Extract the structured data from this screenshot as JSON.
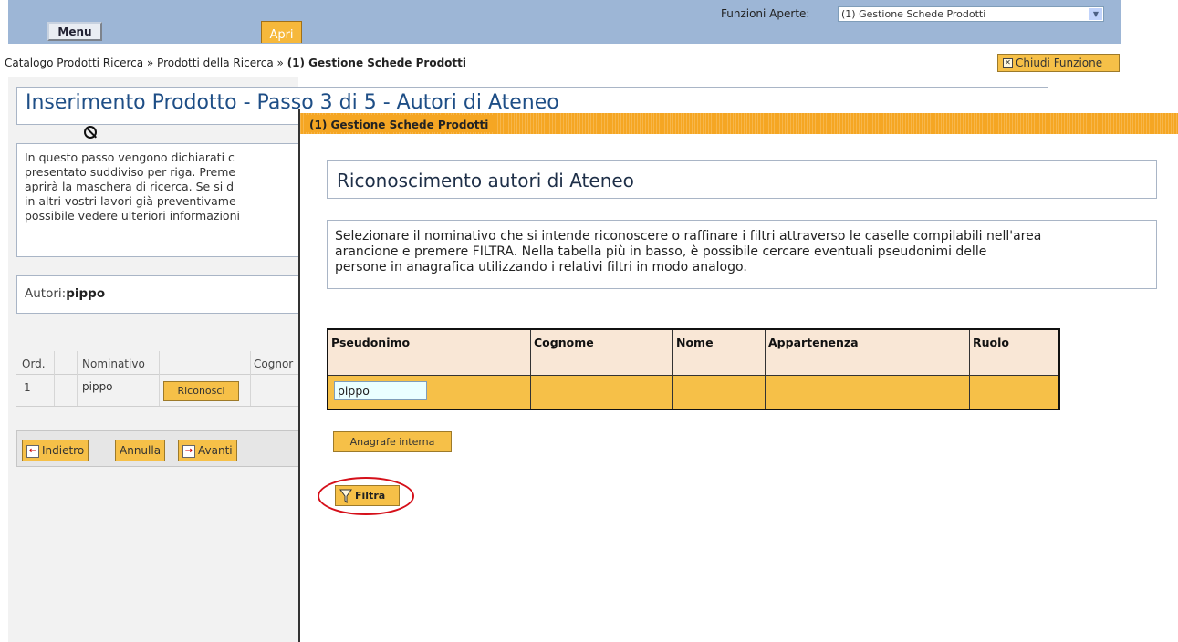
{
  "topbar": {
    "menu_label": "Menu",
    "apri_label": "Apri",
    "funzioni_label": "Funzioni Aperte:",
    "funzioni_selected": "(1) Gestione Schede Prodotti"
  },
  "breadcrumb": {
    "path": "Catalogo Prodotti Ricerca » Prodotti della Ricerca » ",
    "current": "(1) Gestione Schede Prodotti",
    "close_label": "Chiudi Funzione"
  },
  "background_page": {
    "title": "Inserimento Prodotto - Passo 3 di 5 - Autori di Ateneo",
    "intro_lines": [
      "In questo passo vengono dichiarati c",
      "presentato suddiviso per riga. Preme",
      "aprirà la maschera di ricerca. Se si d",
      "in altri vostri lavori già preventivame",
      "possibile vedere ulteriori informazioni"
    ],
    "autori_label": "Autori:",
    "autori_value": "pippo",
    "table": {
      "headers": [
        "Ord.",
        "Nominativo",
        "Cognor"
      ],
      "rows": [
        {
          "ord": "1",
          "nominativo": "pippo",
          "action": "Riconosci"
        }
      ]
    },
    "nav": {
      "back": "Indietro",
      "cancel": "Annulla",
      "next": "Avanti"
    }
  },
  "popup": {
    "window_title": "(1) Gestione Schede Prodotti",
    "heading": "Riconoscimento autori di Ateneo",
    "description_lines": [
      "Selezionare il nominativo che si intende riconoscere o raffinare i filtri attraverso le caselle compilabili nell'area",
      "arancione e premere FILTRA. Nella tabella più in basso, è possibile cercare eventuali pseudonimi delle",
      "persone in anagrafica utilizzando i relativi filtri in modo analogo."
    ],
    "grid_headers": [
      "Pseudonimo",
      "Cognome",
      "Nome",
      "Appartenenza",
      "Ruolo"
    ],
    "pseudonimo_value": "pippo",
    "anagrafe_button": "Anagrafe interna",
    "filtra_button": "Filtra"
  },
  "colors": {
    "topbar": "#9db6d6",
    "button_orange": "#f6c048",
    "popup_bar": "#f5a623",
    "grid_header": "#f9e7d6",
    "highlight_ring": "#d5101a"
  }
}
